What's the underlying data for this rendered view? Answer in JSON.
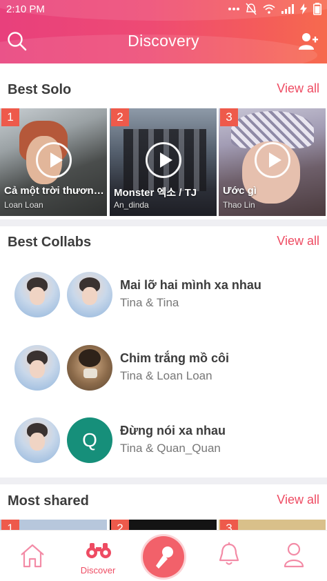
{
  "status_bar": {
    "time": "2:10 PM"
  },
  "header": {
    "title": "Discovery"
  },
  "best_solo": {
    "title": "Best Solo",
    "view_all": "View all",
    "items": [
      {
        "rank": "1",
        "song": "Cả một trời thương...",
        "singer": "Loan Loan"
      },
      {
        "rank": "2",
        "song": "Monster  엑소 / TJ",
        "singer": "An_dinda"
      },
      {
        "rank": "3",
        "song": "Ước gì",
        "singer": "Thao Lin"
      }
    ]
  },
  "best_collabs": {
    "title": "Best Collabs",
    "view_all": "View all",
    "items": [
      {
        "song": "Mai lỡ hai mình xa nhau",
        "artists": "Tina & Tina"
      },
      {
        "song": "Chim trắng mồ côi",
        "artists": "Tina & Loan Loan"
      },
      {
        "song": "Đừng nói xa nhau",
        "artists": "Tina & Quan_Quan",
        "second_avatar_letter": "Q"
      }
    ]
  },
  "most_shared": {
    "title": "Most shared",
    "view_all": "View all",
    "ranks": [
      "1",
      "2",
      "3"
    ]
  },
  "bottom_nav": {
    "discover_label": "Discover"
  },
  "colors": {
    "accent": "#ee4b62",
    "header_start": "#e8407c",
    "header_end": "#f66a4e",
    "rank_badge": "#ee5a4b"
  }
}
